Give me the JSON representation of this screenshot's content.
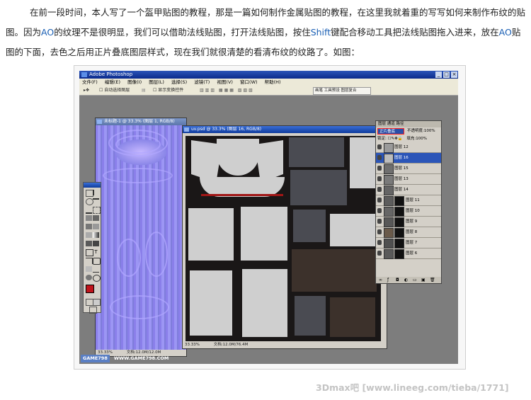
{
  "article": {
    "line1": {
      "a": "在前一段时间，本人写了一个盔甲贴图的教程，那是一篇如何制作金属贴图的教程，在这里我就着重的写写如何来制作布纹的贴",
      "b": "图。因为",
      "ao1": "AO",
      "c": "的纹理不是很明显，我们可以借助法线贴图，打开法线贴图，按住",
      "shift": "Shift",
      "d": "键配合移动工具把法线贴图拖入进来，放在",
      "ao2": "AO",
      "e": "贴图",
      "f": "的下面，去色之后用正片叠底图层样式，现在我们就很清楚的看清布纹的纹路了。如图："
    },
    "highlight_color": "#1a5fb4"
  },
  "photoshop": {
    "app_title": "Adobe Photoshop",
    "menu": [
      "文件(F)",
      "编辑(E)",
      "图像(I)",
      "图层(L)",
      "选择(S)",
      "滤镜(T)",
      "视图(V)",
      "窗口(W)",
      "帮助(H)"
    ],
    "options": {
      "auto_select": "自动选择图层",
      "show_bounds": "显示变换控件",
      "tabs": "画笔  工具预设  图层复合"
    },
    "doc_normal": {
      "title": "未标题-1 @ 33.3% (图层 1, RGB/8)",
      "zoom": "33.33%",
      "doc_size": "文档:12.0M/12.0M"
    },
    "doc_uv": {
      "title": "uv.psd @ 33.3% (图层 16, RGB/8)",
      "zoom": "33.33%",
      "doc_size": "文档:12.0M/76.4M"
    },
    "layers_panel": {
      "tabs": "图层  通道  路径",
      "blend_mode": "正片叠底",
      "opacity_label": "不透明度:",
      "opacity_value": "100%",
      "lock_label": "锁定:",
      "fill_label": "填充:",
      "fill_value": "100%",
      "rows": [
        {
          "name": "图层 12",
          "selected": false,
          "mask": false
        },
        {
          "name": "图层 16",
          "selected": true,
          "mask": false
        },
        {
          "name": "图层 15",
          "selected": false,
          "mask": false
        },
        {
          "name": "图层 13",
          "selected": false,
          "mask": false
        },
        {
          "name": "图层 14",
          "selected": false,
          "mask": false
        },
        {
          "name": "图层 11",
          "selected": false,
          "mask": true
        },
        {
          "name": "图层 10",
          "selected": false,
          "mask": true
        },
        {
          "name": "图层 9",
          "selected": false,
          "mask": true
        },
        {
          "name": "图层 8",
          "selected": false,
          "mask": true
        },
        {
          "name": "图层 7",
          "selected": false,
          "mask": true
        },
        {
          "name": "图层 6",
          "selected": false,
          "mask": true
        }
      ]
    },
    "foreground_color": "#c0141b",
    "badge": "GAME798",
    "site": "WWW.GAME798.COM"
  },
  "watermark": "3Dmax吧 [www.lineeg.com/tieba/1771]"
}
